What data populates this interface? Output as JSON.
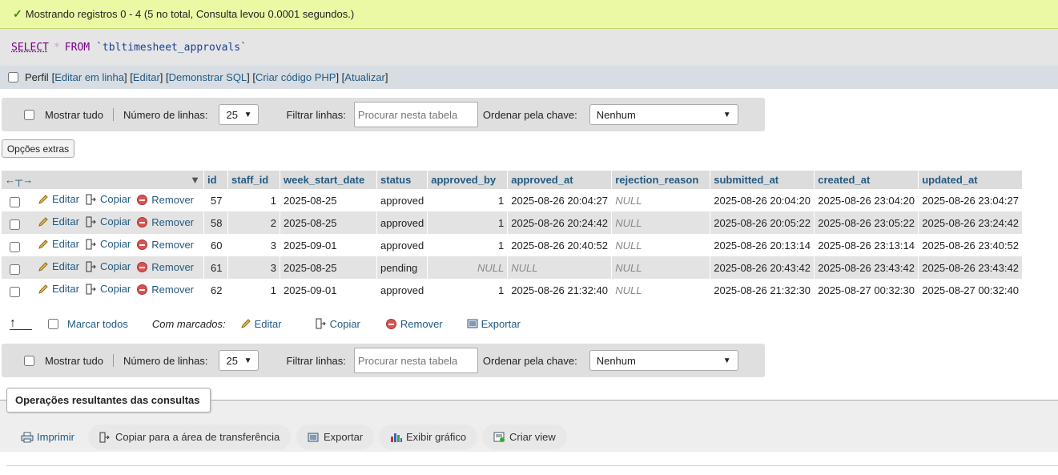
{
  "success": {
    "text": "Mostrando registros 0 - 4 (5 no total, Consulta levou 0.0001 segundos.)"
  },
  "sql": {
    "select": "SELECT",
    "star": "*",
    "from": "FROM",
    "table": "`tbltimesheet_approvals`"
  },
  "profile_bar": {
    "profile_label": "Perfil",
    "links": [
      "Editar em linha",
      "Editar",
      "Demonstrar SQL",
      "Criar código PHP",
      "Atualizar"
    ]
  },
  "nav": {
    "show_all": "Mostrar tudo",
    "rows_label": "Número de linhas:",
    "rows_value": "25",
    "filter_label": "Filtrar linhas:",
    "filter_placeholder": "Procurar nesta tabela",
    "sort_label": "Ordenar pela chave:",
    "sort_value": "Nenhum"
  },
  "extras_button": "Opções extras",
  "table": {
    "columns": [
      "id",
      "staff_id",
      "week_start_date",
      "status",
      "approved_by",
      "approved_at",
      "rejection_reason",
      "submitted_at",
      "created_at",
      "updated_at"
    ],
    "action_labels": {
      "edit": "Editar",
      "copy": "Copiar",
      "remove": "Remover"
    },
    "rows": [
      {
        "id": "57",
        "staff_id": "1",
        "week_start_date": "2025-08-25",
        "status": "approved",
        "approved_by": "1",
        "approved_at": "2025-08-26 20:04:27",
        "rejection_reason": "NULL",
        "submitted_at": "2025-08-26 20:04:20",
        "created_at": "2025-08-26 23:04:20",
        "updated_at": "2025-08-26 23:04:27"
      },
      {
        "id": "58",
        "staff_id": "2",
        "week_start_date": "2025-08-25",
        "status": "approved",
        "approved_by": "1",
        "approved_at": "2025-08-26 20:24:42",
        "rejection_reason": "NULL",
        "submitted_at": "2025-08-26 20:05:22",
        "created_at": "2025-08-26 23:05:22",
        "updated_at": "2025-08-26 23:24:42"
      },
      {
        "id": "60",
        "staff_id": "3",
        "week_start_date": "2025-09-01",
        "status": "approved",
        "approved_by": "1",
        "approved_at": "2025-08-26 20:40:52",
        "rejection_reason": "NULL",
        "submitted_at": "2025-08-26 20:13:14",
        "created_at": "2025-08-26 23:13:14",
        "updated_at": "2025-08-26 23:40:52"
      },
      {
        "id": "61",
        "staff_id": "3",
        "week_start_date": "2025-08-25",
        "status": "pending",
        "approved_by": "NULL",
        "approved_at": "NULL",
        "rejection_reason": "NULL",
        "submitted_at": "2025-08-26 20:43:42",
        "created_at": "2025-08-26 23:43:42",
        "updated_at": "2025-08-26 23:43:42"
      },
      {
        "id": "62",
        "staff_id": "1",
        "week_start_date": "2025-09-01",
        "status": "approved",
        "approved_by": "1",
        "approved_at": "2025-08-26 21:32:40",
        "rejection_reason": "NULL",
        "submitted_at": "2025-08-26 21:32:30",
        "created_at": "2025-08-27 00:32:30",
        "updated_at": "2025-08-27 00:32:40"
      }
    ]
  },
  "bulk": {
    "check_all": "Marcar todos",
    "with_selected": "Com marcados:",
    "edit": "Editar",
    "copy": "Copiar",
    "remove": "Remover",
    "export": "Exportar"
  },
  "operations": {
    "legend": "Operações resultantes das consultas",
    "print": "Imprimir",
    "copy_clipboard": "Copiar para a área de transferência",
    "export": "Exportar",
    "chart": "Exibir gráfico",
    "create_view": "Criar view"
  },
  "colors": {
    "success_bg": "#ebf8a4",
    "link": "#235a81",
    "header_bg": "#dcdcdc"
  },
  "icons": [
    "check-icon",
    "pencil-icon",
    "copy-icon",
    "remove-icon",
    "export-icon",
    "print-icon",
    "chart-icon",
    "view-icon"
  ]
}
